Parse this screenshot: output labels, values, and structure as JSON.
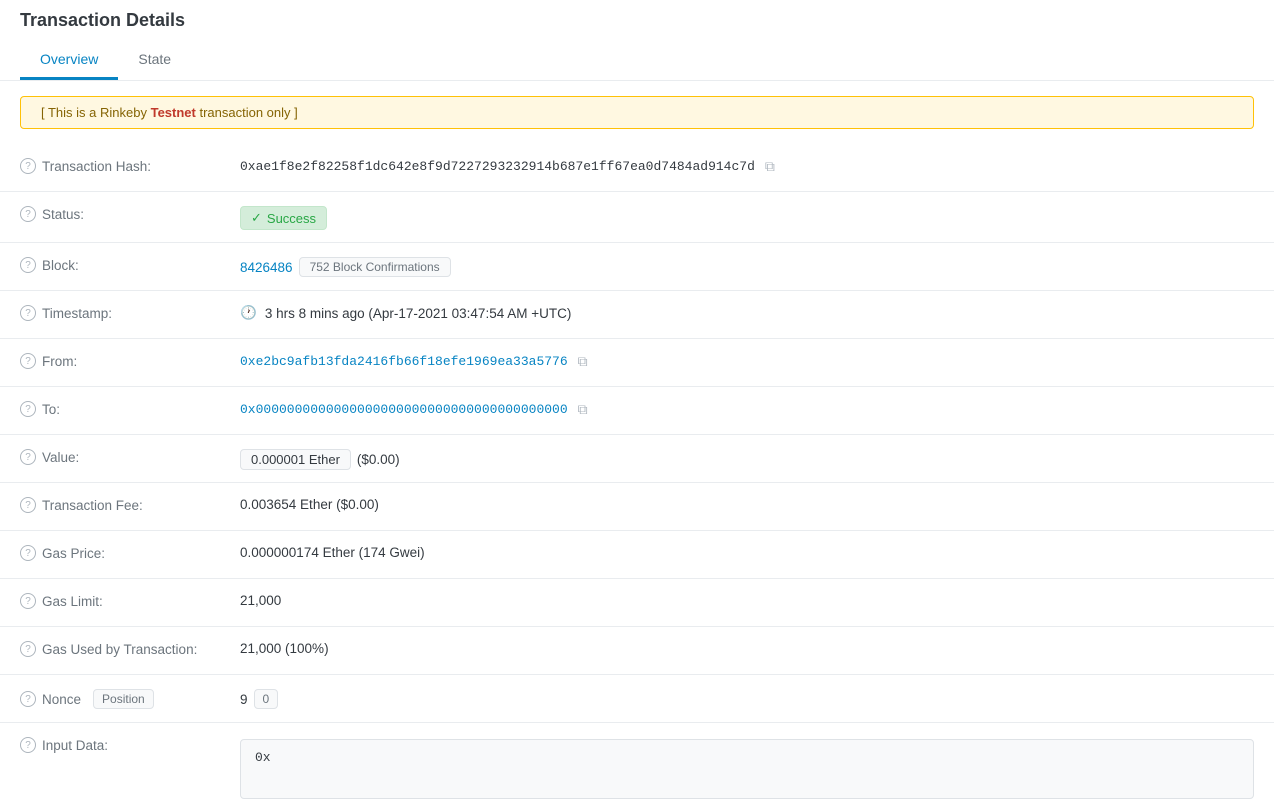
{
  "page": {
    "title": "Transaction Details"
  },
  "tabs": [
    {
      "id": "overview",
      "label": "Overview",
      "active": true
    },
    {
      "id": "state",
      "label": "State",
      "active": false
    }
  ],
  "banner": {
    "prefix": "[ This is a Rinkeby ",
    "bold": "Testnet",
    "suffix": " transaction only ]"
  },
  "fields": {
    "transaction_hash": {
      "label": "Transaction Hash:",
      "value": "0xae1f8e2f82258f1dc642e8f9d7227293232914b687e1ff67ea0d7484ad914c7d"
    },
    "status": {
      "label": "Status:",
      "value": "Success"
    },
    "block": {
      "label": "Block:",
      "number": "8426486",
      "confirmations": "752 Block Confirmations"
    },
    "timestamp": {
      "label": "Timestamp:",
      "value": "3 hrs 8 mins ago (Apr-17-2021 03:47:54 AM +UTC)"
    },
    "from": {
      "label": "From:",
      "value": "0xe2bc9afb13fda2416fb66f18efe1969ea33a5776"
    },
    "to": {
      "label": "To:",
      "value": "0x0000000000000000000000000000000000000000"
    },
    "value": {
      "label": "Value:",
      "badge": "0.000001 Ether",
      "usd": "($0.00)"
    },
    "transaction_fee": {
      "label": "Transaction Fee:",
      "value": "0.003654 Ether ($0.00)"
    },
    "gas_price": {
      "label": "Gas Price:",
      "value": "0.000000174 Ether (174 Gwei)"
    },
    "gas_limit": {
      "label": "Gas Limit:",
      "value": "21,000"
    },
    "gas_used": {
      "label": "Gas Used by Transaction:",
      "value": "21,000 (100%)"
    },
    "nonce": {
      "label": "Nonce",
      "position_label": "Position",
      "nonce_value": "9",
      "position_value": "0"
    },
    "input_data": {
      "label": "Input Data:",
      "value": "0x"
    }
  },
  "icons": {
    "help": "?",
    "copy": "⧉",
    "clock": "🕐",
    "check": "✓"
  }
}
